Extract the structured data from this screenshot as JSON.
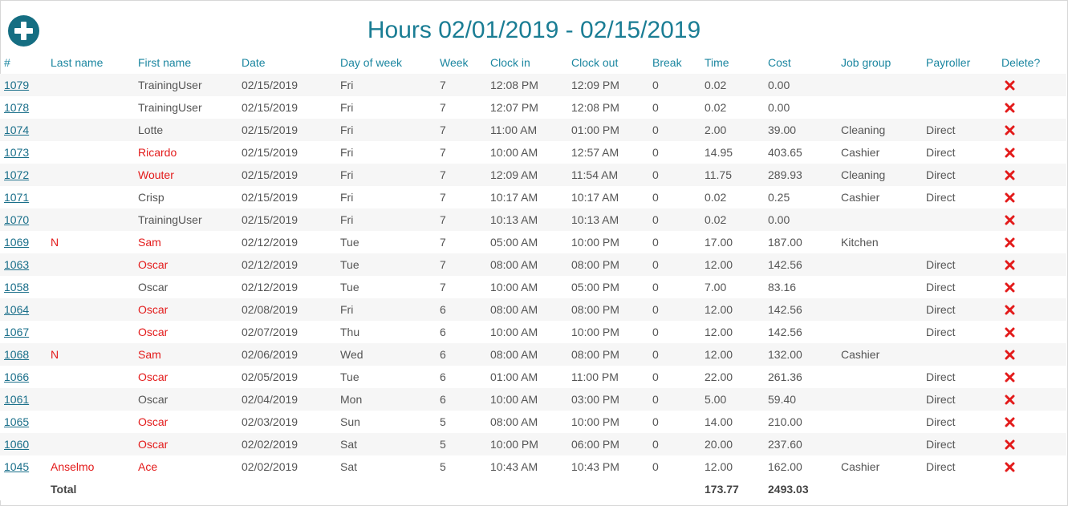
{
  "page": {
    "title": "Hours 02/01/2019 - 02/15/2019",
    "add_icon": "plus-circle-icon",
    "accent_color": "#156e82",
    "highlight_color": "#e31b1b"
  },
  "columns": [
    "#",
    "Last name",
    "First name",
    "Date",
    "Day of week",
    "Week",
    "Clock in",
    "Clock out",
    "Break",
    "Time",
    "Cost",
    "Job group",
    "Payroller",
    "Delete?"
  ],
  "rows": [
    {
      "id": "1079",
      "last": "",
      "first": "TrainingUser",
      "date": "02/15/2019",
      "dow": "Fri",
      "week": "7",
      "in": "12:08 PM",
      "out": "12:09 PM",
      "brk": "0",
      "time": "0.02",
      "cost": "0.00",
      "job": "",
      "pay": "",
      "flag": false
    },
    {
      "id": "1078",
      "last": "",
      "first": "TrainingUser",
      "date": "02/15/2019",
      "dow": "Fri",
      "week": "7",
      "in": "12:07 PM",
      "out": "12:08 PM",
      "brk": "0",
      "time": "0.02",
      "cost": "0.00",
      "job": "",
      "pay": "",
      "flag": false
    },
    {
      "id": "1074",
      "last": "",
      "first": "Lotte",
      "date": "02/15/2019",
      "dow": "Fri",
      "week": "7",
      "in": "11:00 AM",
      "out": "01:00 PM",
      "brk": "0",
      "time": "2.00",
      "cost": "39.00",
      "job": "Cleaning",
      "pay": "Direct",
      "flag": false
    },
    {
      "id": "1073",
      "last": "",
      "first": "Ricardo",
      "date": "02/15/2019",
      "dow": "Fri",
      "week": "7",
      "in": "10:00 AM",
      "out": "12:57 AM",
      "brk": "0",
      "time": "14.95",
      "cost": "403.65",
      "job": "Cashier",
      "pay": "Direct",
      "flag": true
    },
    {
      "id": "1072",
      "last": "",
      "first": "Wouter",
      "date": "02/15/2019",
      "dow": "Fri",
      "week": "7",
      "in": "12:09 AM",
      "out": "11:54 AM",
      "brk": "0",
      "time": "11.75",
      "cost": "289.93",
      "job": "Cleaning",
      "pay": "Direct",
      "flag": true
    },
    {
      "id": "1071",
      "last": "",
      "first": "Crisp",
      "date": "02/15/2019",
      "dow": "Fri",
      "week": "7",
      "in": "10:17 AM",
      "out": "10:17 AM",
      "brk": "0",
      "time": "0.02",
      "cost": "0.25",
      "job": "Cashier",
      "pay": "Direct",
      "flag": false
    },
    {
      "id": "1070",
      "last": "",
      "first": "TrainingUser",
      "date": "02/15/2019",
      "dow": "Fri",
      "week": "7",
      "in": "10:13 AM",
      "out": "10:13 AM",
      "brk": "0",
      "time": "0.02",
      "cost": "0.00",
      "job": "",
      "pay": "",
      "flag": false
    },
    {
      "id": "1069",
      "last": "N",
      "first": "Sam",
      "date": "02/12/2019",
      "dow": "Tue",
      "week": "7",
      "in": "05:00 AM",
      "out": "10:00 PM",
      "brk": "0",
      "time": "17.00",
      "cost": "187.00",
      "job": "Kitchen",
      "pay": "",
      "flag": true
    },
    {
      "id": "1063",
      "last": "",
      "first": "Oscar",
      "date": "02/12/2019",
      "dow": "Tue",
      "week": "7",
      "in": "08:00 AM",
      "out": "08:00 PM",
      "brk": "0",
      "time": "12.00",
      "cost": "142.56",
      "job": "",
      "pay": "Direct",
      "flag": true
    },
    {
      "id": "1058",
      "last": "",
      "first": "Oscar",
      "date": "02/12/2019",
      "dow": "Tue",
      "week": "7",
      "in": "10:00 AM",
      "out": "05:00 PM",
      "brk": "0",
      "time": "7.00",
      "cost": "83.16",
      "job": "",
      "pay": "Direct",
      "flag": false
    },
    {
      "id": "1064",
      "last": "",
      "first": "Oscar",
      "date": "02/08/2019",
      "dow": "Fri",
      "week": "6",
      "in": "08:00 AM",
      "out": "08:00 PM",
      "brk": "0",
      "time": "12.00",
      "cost": "142.56",
      "job": "",
      "pay": "Direct",
      "flag": true
    },
    {
      "id": "1067",
      "last": "",
      "first": "Oscar",
      "date": "02/07/2019",
      "dow": "Thu",
      "week": "6",
      "in": "10:00 AM",
      "out": "10:00 PM",
      "brk": "0",
      "time": "12.00",
      "cost": "142.56",
      "job": "",
      "pay": "Direct",
      "flag": true
    },
    {
      "id": "1068",
      "last": "N",
      "first": "Sam",
      "date": "02/06/2019",
      "dow": "Wed",
      "week": "6",
      "in": "08:00 AM",
      "out": "08:00 PM",
      "brk": "0",
      "time": "12.00",
      "cost": "132.00",
      "job": "Cashier",
      "pay": "",
      "flag": true
    },
    {
      "id": "1066",
      "last": "",
      "first": "Oscar",
      "date": "02/05/2019",
      "dow": "Tue",
      "week": "6",
      "in": "01:00 AM",
      "out": "11:00 PM",
      "brk": "0",
      "time": "22.00",
      "cost": "261.36",
      "job": "",
      "pay": "Direct",
      "flag": true
    },
    {
      "id": "1061",
      "last": "",
      "first": "Oscar",
      "date": "02/04/2019",
      "dow": "Mon",
      "week": "6",
      "in": "10:00 AM",
      "out": "03:00 PM",
      "brk": "0",
      "time": "5.00",
      "cost": "59.40",
      "job": "",
      "pay": "Direct",
      "flag": false
    },
    {
      "id": "1065",
      "last": "",
      "first": "Oscar",
      "date": "02/03/2019",
      "dow": "Sun",
      "week": "5",
      "in": "08:00 AM",
      "out": "10:00 PM",
      "brk": "0",
      "time": "14.00",
      "cost": "210.00",
      "job": "",
      "pay": "Direct",
      "flag": true
    },
    {
      "id": "1060",
      "last": "",
      "first": "Oscar",
      "date": "02/02/2019",
      "dow": "Sat",
      "week": "5",
      "in": "10:00 PM",
      "out": "06:00 PM",
      "brk": "0",
      "time": "20.00",
      "cost": "237.60",
      "job": "",
      "pay": "Direct",
      "flag": true
    },
    {
      "id": "1045",
      "last": "Anselmo",
      "first": "Ace",
      "date": "02/02/2019",
      "dow": "Sat",
      "week": "5",
      "in": "10:43 AM",
      "out": "10:43 PM",
      "brk": "0",
      "time": "12.00",
      "cost": "162.00",
      "job": "Cashier",
      "pay": "Direct",
      "flag": true
    }
  ],
  "delete_icon": "delete-x-icon",
  "totals": {
    "label": "Total",
    "time": "173.77",
    "cost": "2493.03"
  }
}
